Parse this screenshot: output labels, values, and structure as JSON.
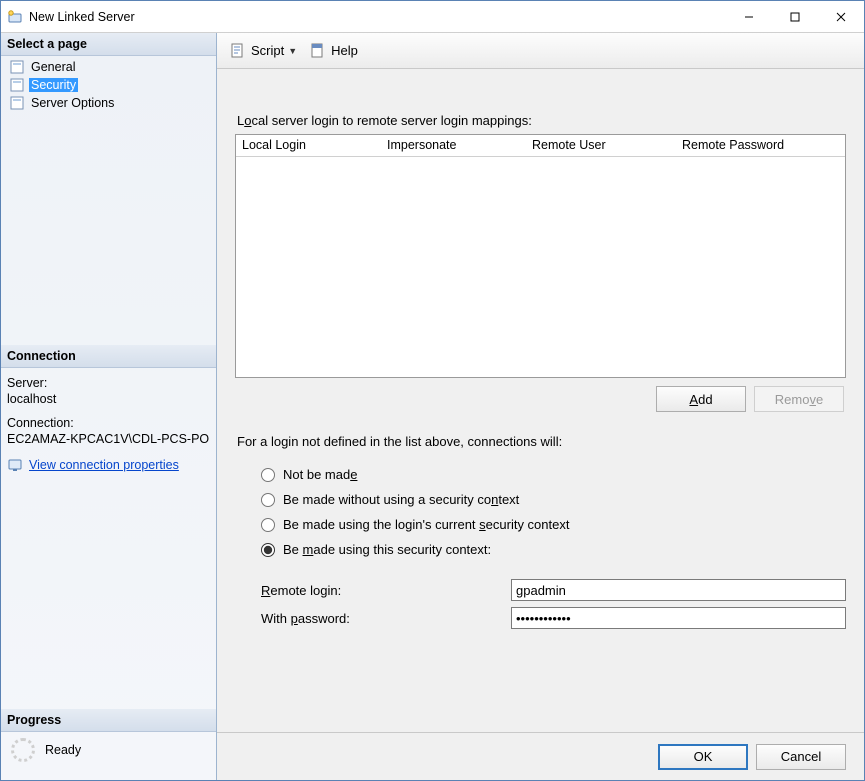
{
  "window": {
    "title": "New Linked Server"
  },
  "sidebar": {
    "header": "Select a page",
    "pages": [
      {
        "label": "General"
      },
      {
        "label": "Security"
      },
      {
        "label": "Server Options"
      }
    ],
    "connection": {
      "header": "Connection",
      "server_label": "Server:",
      "server_value": "localhost",
      "connection_label": "Connection:",
      "connection_value": "EC2AMAZ-KPCAC1V\\CDL-PCS-PO",
      "view_properties_link": "View connection properties"
    },
    "progress": {
      "header": "Progress",
      "status": "Ready"
    }
  },
  "toolbar": {
    "script_label": "Script",
    "help_label": "Help"
  },
  "main": {
    "mappings_label": "Local server login to remote server login mappings:",
    "grid": {
      "columns": [
        "Local Login",
        "Impersonate",
        "Remote User",
        "Remote Password"
      ]
    },
    "add_btn": "Add",
    "remove_btn": "Remove",
    "login_note": "For a login not defined in the list above, connections will:",
    "radios": {
      "not_made": "Not be made",
      "without_ctx": "Be made without using a security context",
      "current_ctx": "Be made using the login's current security context",
      "this_ctx": "Be made using this security context:"
    },
    "credentials": {
      "remote_login_label": "Remote login:",
      "remote_login_value": "gpadmin",
      "password_label": "With password:",
      "password_value": "************"
    }
  },
  "footer": {
    "ok": "OK",
    "cancel": "Cancel"
  }
}
